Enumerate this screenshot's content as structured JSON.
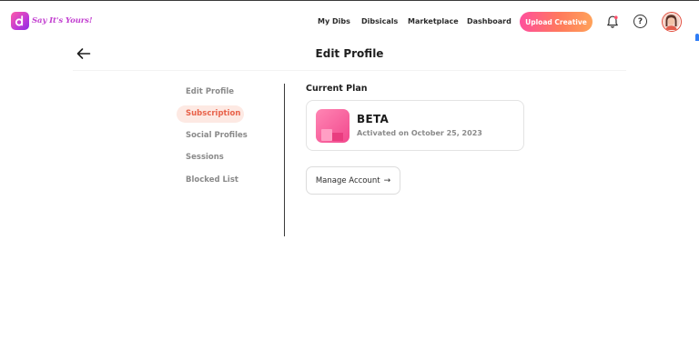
{
  "app": {
    "logo_text": "Say It's Yours!",
    "accent": "#e8624a",
    "brand_gradient": [
      "#ff4f9d",
      "#ffa25a"
    ]
  },
  "nav": {
    "links": [
      "My Dibs",
      "Dibsicals",
      "Marketplace",
      "Dashboard"
    ],
    "upload_label": "Upload Creative",
    "help_label": "?"
  },
  "page": {
    "title": "Edit Profile"
  },
  "sidebar": {
    "items": [
      {
        "label": "Edit Profile",
        "active": false
      },
      {
        "label": "Subscription",
        "active": true
      },
      {
        "label": "Social Profiles",
        "active": false
      },
      {
        "label": "Sessions",
        "active": false
      },
      {
        "label": "Blocked List",
        "active": false
      }
    ]
  },
  "plan": {
    "section_label": "Current Plan",
    "name": "BETA",
    "activated": "Activated on October 25, 2023"
  },
  "actions": {
    "manage_label": "Manage Account",
    "manage_arrow": "→"
  }
}
